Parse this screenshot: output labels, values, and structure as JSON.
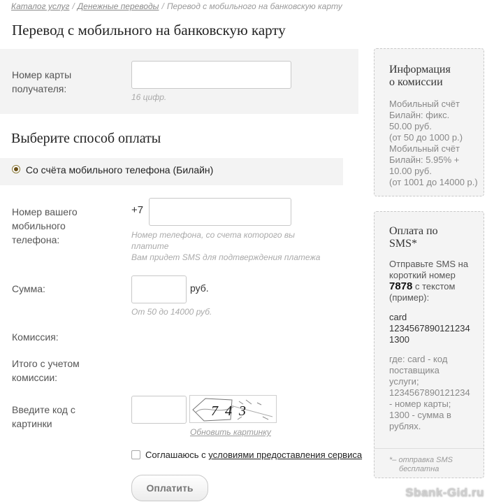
{
  "breadcrumb": {
    "items": [
      "Каталог услуг",
      "Денежные переводы"
    ],
    "separator": "/",
    "current": "Перевод с мобильного на банковскую карту"
  },
  "page_title": "Перевод с мобильного на банковскую карту",
  "card_field": {
    "label_line1": "Номер карты",
    "label_line2": "получателя:",
    "value": "",
    "hint": "16 цифр."
  },
  "payment_section": {
    "title": "Выберите способ оплаты",
    "method_label": "Со счёта мобильного телефона (Билайн)",
    "method_selected": true
  },
  "phone_field": {
    "label_line1": "Номер вашего",
    "label_line2": "мобильного",
    "label_line3": "телефона:",
    "prefix": "+7",
    "value": "",
    "hint_line1": "Номер телефона, со счета которого вы",
    "hint_line2": "платите",
    "hint_line3": "Вам придет SMS для подтверждения платежа"
  },
  "amount_field": {
    "label": "Сумма:",
    "value": "",
    "unit": "руб.",
    "hint": "От 50 до 14000 руб."
  },
  "commission": {
    "label": "Комиссия:"
  },
  "total": {
    "label_line1": "Итого с учетом",
    "label_line2": "комиссии:"
  },
  "captcha": {
    "label_line1": "Введите код с",
    "label_line2": "картинки",
    "value": "",
    "image_text": "743",
    "refresh_link": "Обновить картинку"
  },
  "agreement": {
    "checked": false,
    "text_before": "Соглашаюсь с ",
    "link_text": "условиями предоставления сервиса"
  },
  "submit": {
    "label": "Оплатить"
  },
  "info_panel": {
    "title_line1": "Информация",
    "title_line2": "о комиссии",
    "lines": [
      "Мобильный счёт",
      "Билайн:  фикс.",
      "50.00 руб.",
      "(от 50 до 1000 р.)",
      "Мобильный счёт",
      "Билайн:  5.95% +",
      "10.00 руб.",
      "(от 1001 до 14000 р.)"
    ]
  },
  "sms_panel": {
    "title_line1": "Оплата по",
    "title_line2": "SMS*",
    "intro_line1": "Отправьте SMS на",
    "intro_line2": "короткий номер",
    "short_number": "7878",
    "after_number": " с текстом",
    "example": "(пример):",
    "sms_line1": "card",
    "sms_line2": "1234567890121234",
    "sms_line3": "1300",
    "legend": [
      "где: card - код",
      "поставщика",
      "услуги;",
      "1234567890121234",
      "- номер карты;",
      "1300 - сумма в",
      "рублях."
    ],
    "footnote_line1": "*– отправка SMS",
    "footnote_line2": "бесплатна"
  },
  "watermark": "Sbank-Gid.ru"
}
